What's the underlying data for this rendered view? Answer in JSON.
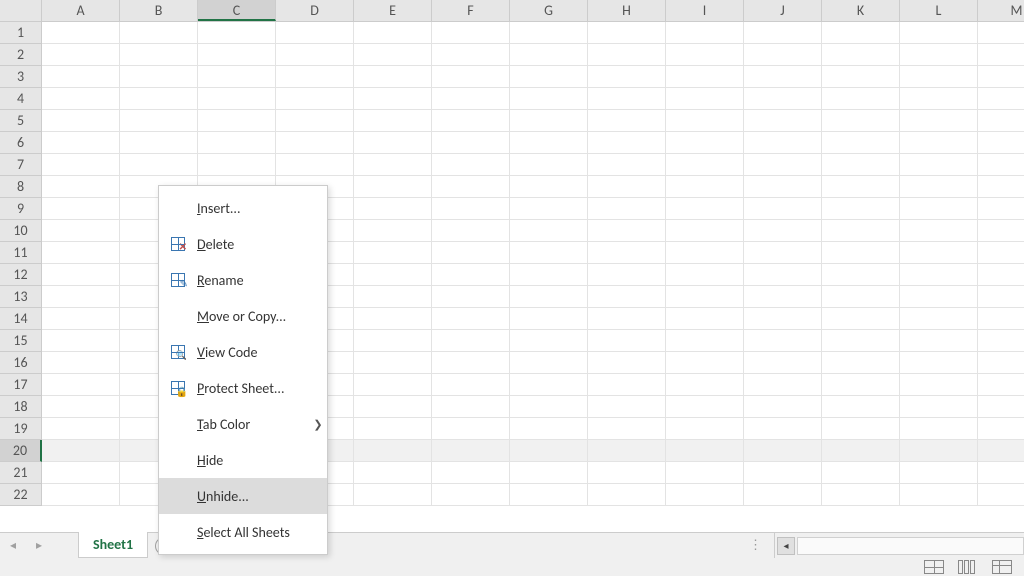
{
  "columns": [
    "A",
    "B",
    "C",
    "D",
    "E",
    "F",
    "G",
    "H",
    "I",
    "J",
    "K",
    "L",
    "M"
  ],
  "selected_column_index": 2,
  "row_count": 22,
  "selected_row_index": 19,
  "sheet_tab": {
    "name": "Sheet1"
  },
  "context_menu": {
    "items": [
      {
        "key": "insert",
        "label_pre": "",
        "u": "I",
        "label_post": "nsert...",
        "icon": "",
        "has_arrow": false
      },
      {
        "key": "delete",
        "label_pre": "",
        "u": "D",
        "label_post": "elete",
        "icon": "delete",
        "has_arrow": false
      },
      {
        "key": "rename",
        "label_pre": "",
        "u": "R",
        "label_post": "ename",
        "icon": "rename",
        "has_arrow": false
      },
      {
        "key": "move",
        "label_pre": "",
        "u": "M",
        "label_post": "ove or Copy...",
        "icon": "",
        "has_arrow": false
      },
      {
        "key": "viewcode",
        "label_pre": "",
        "u": "V",
        "label_post": "iew Code",
        "icon": "view",
        "has_arrow": false
      },
      {
        "key": "protect",
        "label_pre": "",
        "u": "P",
        "label_post": "rotect Sheet...",
        "icon": "protect",
        "has_arrow": false
      },
      {
        "key": "tabcolor",
        "label_pre": "",
        "u": "T",
        "label_post": "ab Color",
        "icon": "",
        "has_arrow": true
      },
      {
        "key": "hide",
        "label_pre": "",
        "u": "H",
        "label_post": "ide",
        "icon": "",
        "has_arrow": false
      },
      {
        "key": "unhide",
        "label_pre": "",
        "u": "U",
        "label_post": "nhide...",
        "icon": "",
        "has_arrow": false,
        "hover": true
      },
      {
        "key": "selectall",
        "label_pre": "",
        "u": "S",
        "label_post": "elect All Sheets",
        "icon": "",
        "has_arrow": false
      }
    ]
  }
}
